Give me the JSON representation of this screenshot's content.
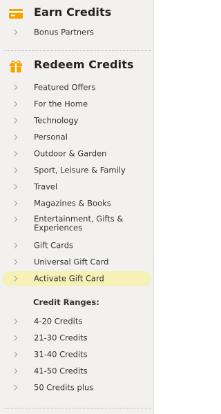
{
  "earn": {
    "title": "Earn Credits",
    "icon": "credit-card-icon",
    "items": [
      {
        "label": "Bonus Partners"
      }
    ]
  },
  "redeem": {
    "title": "Redeem Credits",
    "icon": "gift-icon",
    "items": [
      {
        "label": "Featured Offers"
      },
      {
        "label": "For the Home"
      },
      {
        "label": "Technology"
      },
      {
        "label": "Personal"
      },
      {
        "label": "Outdoor & Garden"
      },
      {
        "label": "Sport, Leisure & Family"
      },
      {
        "label": "Travel"
      },
      {
        "label": "Magazines & Books"
      },
      {
        "label": "Entertainment, Gifts & Experiences"
      },
      {
        "label": "Gift Cards"
      },
      {
        "label": "Universal Gift Card"
      },
      {
        "label": "Activate Gift Card",
        "active": true
      }
    ]
  },
  "credit_ranges": {
    "heading": "Credit Ranges:",
    "items": [
      {
        "label": "4-20 Credits"
      },
      {
        "label": "21-30 Credits"
      },
      {
        "label": "31-40 Credits"
      },
      {
        "label": "41-50 Credits"
      },
      {
        "label": "50 Credits plus"
      }
    ]
  },
  "colors": {
    "accent_orange": "#f5a300",
    "active_highlight": "#f6f1b6",
    "panel_background": "#f2f1ef"
  }
}
